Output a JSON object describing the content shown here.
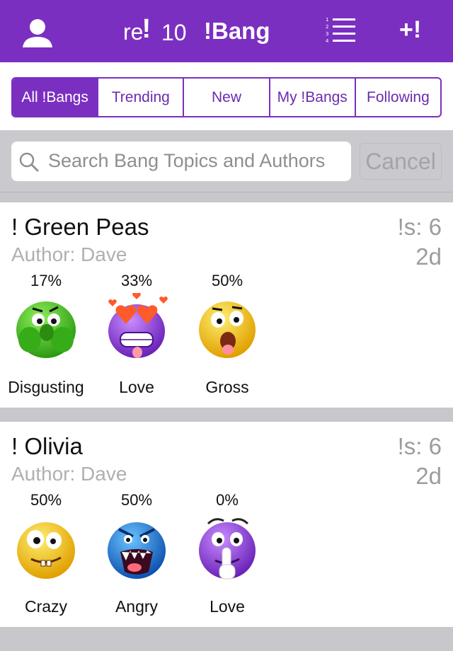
{
  "header": {
    "reputation_prefix": "re",
    "reputation_mark": "!",
    "reputation_value": "10",
    "app_title": "!Bang",
    "new_bang_label": "+!"
  },
  "tabs": [
    "All !Bangs",
    "Trending",
    "New",
    "My !Bangs",
    "Following"
  ],
  "active_tab": "All !Bangs",
  "search": {
    "placeholder": "Search Bang Topics and Authors",
    "cancel_label": "Cancel"
  },
  "bangs": [
    {
      "title": "! Green Peas",
      "author": "Author: Dave",
      "count": "!s: 6",
      "age": "2d",
      "reactions": [
        {
          "percent": "17%",
          "label": "Disgusting",
          "emoji": "disgusted-green-face-icon"
        },
        {
          "percent": "33%",
          "label": "Love",
          "emoji": "heart-eyes-purple-face-icon"
        },
        {
          "percent": "50%",
          "label": "Gross",
          "emoji": "gross-yellow-face-icon"
        }
      ]
    },
    {
      "title": "! Olivia",
      "author": "Author: Dave",
      "count": "!s: 6",
      "age": "2d",
      "reactions": [
        {
          "percent": "50%",
          "label": "Crazy",
          "emoji": "crazy-yellow-face-icon"
        },
        {
          "percent": "50%",
          "label": "Angry",
          "emoji": "angry-blue-face-icon"
        },
        {
          "percent": "0%",
          "label": "Love",
          "emoji": "shushing-purple-face-icon"
        }
      ]
    }
  ],
  "colors": {
    "brand": "#7b2fc0",
    "green_face": "#3cb81e",
    "purple_face": "#8b3fd8",
    "yellow_face": "#f2c21a",
    "blue_face": "#1e78d8"
  }
}
